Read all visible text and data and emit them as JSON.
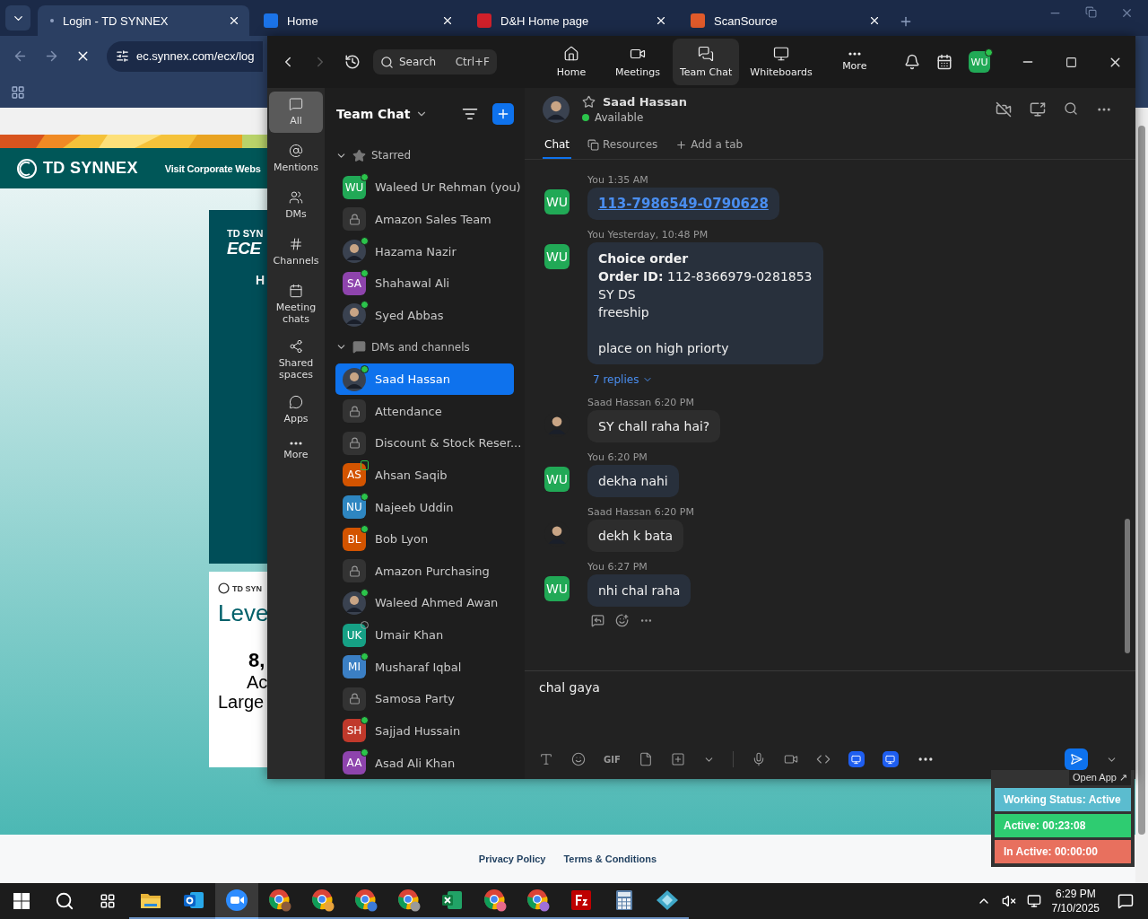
{
  "browser": {
    "tabs": [
      {
        "title": "Login - TD SYNNEX",
        "kind": "loading",
        "selected": true
      },
      {
        "title": "Home",
        "kind": "synnex",
        "selected": false
      },
      {
        "title": "D&H Home page",
        "kind": "dh",
        "selected": false
      },
      {
        "title": "ScanSource",
        "kind": "scansource",
        "selected": false
      }
    ],
    "address": "ec.synnex.com/ecx/log",
    "page": {
      "nav_logo": "TD SYNNEX",
      "nav_link": "Visit Corporate Webs",
      "promo": {
        "eyebrow": "TD SYN",
        "title": "ECE",
        "line": "H"
      },
      "info": {
        "logo": "TD SYN",
        "heading": "Leve",
        "figure": "8,",
        "lines": [
          "Ac",
          "Large"
        ]
      },
      "footer_links": [
        "Privacy Policy",
        "Terms & Conditions"
      ]
    }
  },
  "zoom": {
    "search": {
      "placeholder": "Search",
      "shortcut": "Ctrl+F"
    },
    "nav": [
      {
        "kind": "home",
        "label": "Home",
        "selected": false
      },
      {
        "kind": "meetings",
        "label": "Meetings",
        "selected": false
      },
      {
        "kind": "chat",
        "label": "Team Chat",
        "selected": true
      },
      {
        "kind": "whiteboards",
        "label": "Whiteboards",
        "selected": false
      },
      {
        "kind": "more",
        "label": "More",
        "selected": false
      }
    ],
    "profile": {
      "initials": "WU",
      "status": {
        "kind": "online"
      }
    },
    "rail": [
      {
        "kind": "all",
        "label": "All",
        "selected": true
      },
      {
        "kind": "mentions",
        "label": "Mentions",
        "selected": false
      },
      {
        "kind": "dms",
        "label": "DMs",
        "selected": false
      },
      {
        "kind": "channels",
        "label": "Channels",
        "selected": false
      },
      {
        "kind": "meeting",
        "label": "Meeting chats",
        "selected": false
      },
      {
        "kind": "shared",
        "label": "Shared spaces",
        "selected": false
      },
      {
        "kind": "apps",
        "label": "Apps",
        "selected": false
      },
      {
        "kind": "more",
        "label": "More",
        "selected": false
      }
    ],
    "list_title": "Team Chat",
    "sections": [
      {
        "label": "Starred",
        "kind": "starred",
        "expanded": true,
        "items": [
          {
            "name": "Waleed Ur Rehman (you)",
            "kind": "initials",
            "initials": "WU",
            "color": "#21a956",
            "status": {
              "kind": "online"
            },
            "selected": false
          },
          {
            "name": "Amazon Sales Team",
            "kind": "lock",
            "selected": false
          },
          {
            "name": "Hazama Nazir",
            "status": {
              "kind": "online"
            },
            "selected": false
          },
          {
            "name": "Shahawal Ali",
            "kind": "initials",
            "initials": "SA",
            "color": "#8e44ad",
            "status": {
              "kind": "online"
            },
            "selected": false
          },
          {
            "name": "Syed Abbas",
            "status": {
              "kind": "online"
            },
            "selected": false
          }
        ]
      },
      {
        "label": "DMs and channels",
        "kind": "dms",
        "expanded": true,
        "items": [
          {
            "name": "Saad Hassan",
            "status": {
              "kind": "online"
            },
            "selected": true
          },
          {
            "name": "Attendance",
            "kind": "lock",
            "selected": false
          },
          {
            "name": "Discount & Stock Reser...",
            "kind": "lock",
            "selected": false
          },
          {
            "name": "Ahsan Saqib",
            "kind": "initials",
            "initials": "AS",
            "color": "#d35400",
            "status": {
              "kind": "mobile"
            },
            "selected": false
          },
          {
            "name": "Najeeb Uddin",
            "kind": "initials",
            "initials": "NU",
            "color": "#2e86c1",
            "status": {
              "kind": "online"
            },
            "selected": false
          },
          {
            "name": "Bob Lyon",
            "kind": "initials",
            "initials": "BL",
            "color": "#d35400",
            "status": {
              "kind": "online"
            },
            "selected": false
          },
          {
            "name": "Amazon Purchasing",
            "kind": "lock",
            "selected": false
          },
          {
            "name": "Waleed Ahmed Awan",
            "status": {
              "kind": "online"
            },
            "selected": false
          },
          {
            "name": "Umair Khan",
            "kind": "initials",
            "initials": "UK",
            "color": "#16a085",
            "status": {
              "kind": "offline"
            },
            "selected": false
          },
          {
            "name": "Musharaf Iqbal",
            "kind": "initials",
            "initials": "MI",
            "color": "#3b7fc4",
            "status": {
              "kind": "online"
            },
            "selected": false
          },
          {
            "name": "Samosa Party",
            "kind": "lock",
            "selected": false
          },
          {
            "name": "Sajjad Hussain",
            "kind": "initials",
            "initials": "SH",
            "color": "#c0392b",
            "status": {
              "kind": "online"
            },
            "selected": false
          },
          {
            "name": "Asad Ali Khan",
            "kind": "initials",
            "initials": "AA",
            "color": "#8e44ad",
            "status": {
              "kind": "online"
            },
            "selected": false
          }
        ]
      }
    ],
    "chat": {
      "name": "Saad Hassan",
      "presence": "Available",
      "tabs": [
        {
          "kind": "chat",
          "label": "Chat",
          "selected": true
        },
        {
          "kind": "resources",
          "label": "Resources",
          "selected": false
        },
        {
          "kind": "add",
          "label": "Add a tab",
          "selected": false
        }
      ],
      "messages": [
        {
          "sender": "You",
          "time": "1:35 AM",
          "own": true,
          "avatar": "WU",
          "body": {
            "kind": "link",
            "text": "113-7986549-0790628"
          },
          "hover_actions": false
        },
        {
          "sender": "You",
          "time": "Yesterday, 10:48 PM",
          "own": true,
          "avatar": "WU",
          "body": {
            "kind": "text",
            "paragraphs": [
              [
                "**Choice order**",
                "**Order ID:** 112-8366979-0281853",
                "SY DS",
                "freeship"
              ],
              [
                "place on high priorty"
              ]
            ]
          },
          "replies": "7 replies",
          "hover_actions": false
        },
        {
          "sender": "Saad Hassan",
          "time": "6:20 PM",
          "own": false,
          "body": {
            "kind": "text",
            "paragraphs": [
              [
                "SY chall raha hai?"
              ]
            ]
          },
          "hover_actions": false
        },
        {
          "sender": "You",
          "time": "6:20 PM",
          "own": true,
          "avatar": "WU",
          "body": {
            "kind": "text",
            "paragraphs": [
              [
                "dekha nahi"
              ]
            ]
          },
          "hover_actions": false
        },
        {
          "sender": "Saad Hassan",
          "time": "6:20 PM",
          "own": false,
          "body": {
            "kind": "text",
            "paragraphs": [
              [
                "dekh k bata"
              ]
            ]
          },
          "hover_actions": false
        },
        {
          "sender": "You",
          "time": "6:27 PM",
          "own": true,
          "avatar": "WU",
          "body": {
            "kind": "text",
            "paragraphs": [
              [
                "nhi chal raha"
              ]
            ]
          },
          "hover_actions": true
        }
      ],
      "draft": "chal gaya",
      "tools": [
        {
          "kind": "format"
        },
        {
          "kind": "emoji"
        },
        {
          "kind": "gif",
          "label": "GIF"
        },
        {
          "kind": "file"
        },
        {
          "kind": "screenshot"
        },
        {
          "kind": "caret"
        },
        {
          "kind": "divider"
        },
        {
          "kind": "mic"
        },
        {
          "kind": "video"
        },
        {
          "kind": "code"
        },
        {
          "kind": "app"
        },
        {
          "kind": "app"
        },
        {
          "kind": "more"
        }
      ]
    }
  },
  "widget": {
    "open_app": "Open App ↗",
    "rows": [
      {
        "text": "Working Status: Active",
        "color": "#5bbccf"
      },
      {
        "text": "Active: 00:23:08",
        "color": "#2ecc71"
      },
      {
        "text": "In Active: 00:00:00",
        "color": "#e8705e"
      }
    ]
  },
  "taskbar": {
    "apps": [
      {
        "kind": "explorer",
        "selected": false
      },
      {
        "kind": "outlook",
        "selected": false
      },
      {
        "kind": "zoom",
        "selected": true
      },
      {
        "kind": "chrome",
        "color": "#8b5a3c",
        "selected": false
      },
      {
        "kind": "chrome",
        "color": "#e8a33c",
        "selected": false
      },
      {
        "kind": "chrome",
        "color": "#3c7bd8",
        "selected": false
      },
      {
        "kind": "chrome",
        "color": "#9a9a9a",
        "selected": false
      },
      {
        "kind": "excel",
        "selected": false
      },
      {
        "kind": "chrome",
        "color": "#e86a8a",
        "selected": false
      },
      {
        "kind": "chrome",
        "color": "#a070d8",
        "selected": false
      },
      {
        "kind": "filezilla",
        "selected": false
      },
      {
        "kind": "calculator",
        "selected": false
      },
      {
        "kind": "diamond",
        "selected": false
      }
    ],
    "time": "6:29 PM",
    "date": "7/10/2025"
  }
}
